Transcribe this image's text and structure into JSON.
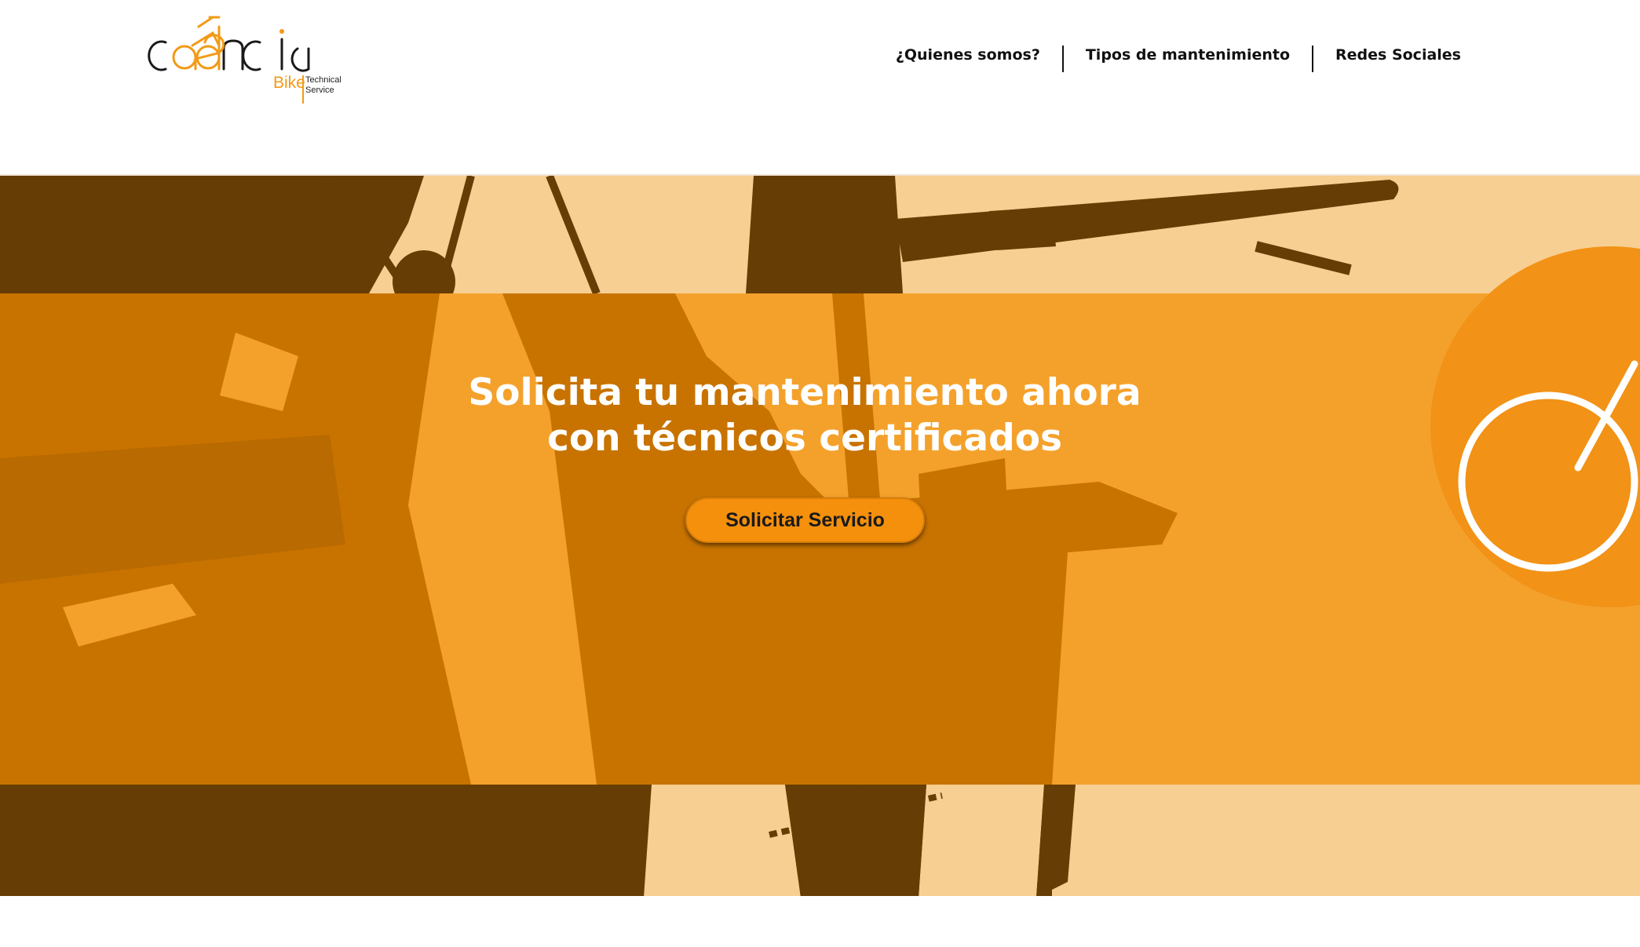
{
  "brand": {
    "wordmark": "cadencia",
    "sub_bike": "Bike",
    "sub_technical": "Technical Service",
    "accent_color": "#f29a16"
  },
  "nav": {
    "items": [
      {
        "label": "¿Quienes somos?"
      },
      {
        "label": "Tipos de mantenimiento"
      },
      {
        "label": "Redes Sociales"
      }
    ]
  },
  "hero": {
    "headline_line1": "Solicita tu mantenimiento ahora",
    "headline_line2": "con técnicos certificados",
    "cta_label": "Solicitar Servicio",
    "colors": {
      "light_band": "#f8cf92",
      "dark_band": "#663d04",
      "mid_band": "#f4a12c",
      "silhouette": "#c87300",
      "circle": "#f29216"
    },
    "icons": [
      "bicycle-wheel-icon"
    ]
  }
}
